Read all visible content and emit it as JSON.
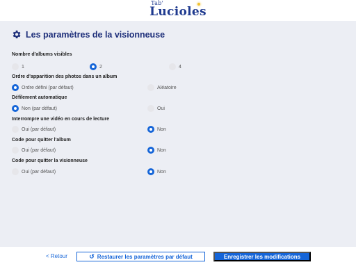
{
  "logo": {
    "prefix": "Tab'",
    "name": "Lucioles"
  },
  "page": {
    "title": "Les paramètres de la visionneuse"
  },
  "settings": [
    {
      "label": "Nombre d'albums visibles",
      "options": [
        {
          "label": "1",
          "selected": false
        },
        {
          "label": "2",
          "selected": true
        },
        {
          "label": "4",
          "selected": false
        }
      ]
    },
    {
      "label": "Ordre d'apparition des photos dans un album",
      "options": [
        {
          "label": "Ordre défini (par défaut)",
          "selected": true
        },
        {
          "label": "Aléatoire",
          "selected": false
        }
      ]
    },
    {
      "label": "Défilement automatique",
      "options": [
        {
          "label": "Non (par défaut)",
          "selected": true
        },
        {
          "label": "Oui",
          "selected": false
        }
      ]
    },
    {
      "label": "Interrompre une vidéo en cours de lecture",
      "options": [
        {
          "label": "Oui (par défaut)",
          "selected": false
        },
        {
          "label": "Non",
          "selected": true
        }
      ]
    },
    {
      "label": "Code pour quitter l'album",
      "options": [
        {
          "label": "Oui (par défaut)",
          "selected": false
        },
        {
          "label": "Non",
          "selected": true
        }
      ]
    },
    {
      "label": "Code pour quitter la visionneuse",
      "options": [
        {
          "label": "Oui (par défaut)",
          "selected": false
        },
        {
          "label": "Non",
          "selected": true
        }
      ]
    }
  ],
  "footer": {
    "back": "< Retour",
    "reset": "Restaurer les paramètres par défaut",
    "save": "Enregistrer les modifications"
  },
  "colors": {
    "accent": "#1565d8",
    "title": "#1e2f7a",
    "panel": "#eceef4"
  }
}
